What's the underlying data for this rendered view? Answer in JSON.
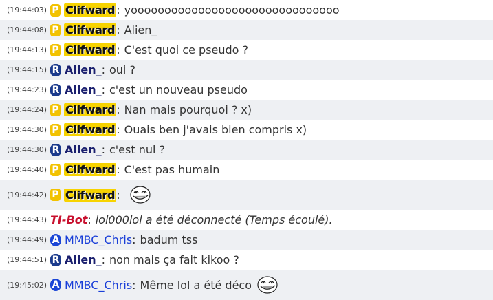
{
  "messages": [
    {
      "time": "(19:44:03)",
      "badge": "P",
      "user": "Clifward",
      "text": "yooooooooooooooooooooooooooooooo"
    },
    {
      "time": "(19:44:08)",
      "badge": "P",
      "user": "Clifward",
      "text": "Alien_"
    },
    {
      "time": "(19:44:13)",
      "badge": "P",
      "user": "Clifward",
      "text": "C'est quoi ce pseudo ?"
    },
    {
      "time": "(19:44:15)",
      "badge": "R",
      "user": "Alien_",
      "text": "oui ?"
    },
    {
      "time": "(19:44:23)",
      "badge": "R",
      "user": "Alien_",
      "text": "c'est un nouveau pseudo"
    },
    {
      "time": "(19:44:24)",
      "badge": "P",
      "user": "Clifward",
      "text": "Nan mais pourquoi ? x)"
    },
    {
      "time": "(19:44:30)",
      "badge": "P",
      "user": "Clifward",
      "text": "Ouais ben j'avais bien compris x)"
    },
    {
      "time": "(19:44:30)",
      "badge": "R",
      "user": "Alien_",
      "text": "c'est nul ?"
    },
    {
      "time": "(19:44:40)",
      "badge": "P",
      "user": "Clifward",
      "text": "C'est pas humain"
    },
    {
      "time": "(19:44:42)",
      "badge": "P",
      "user": "Clifward",
      "text": "",
      "icon": "trollface-icon"
    },
    {
      "time": "(19:44:43)",
      "badge": "",
      "user": "TI-Bot",
      "text": "lol000lol a été déconnecté (Temps écoulé)."
    },
    {
      "time": "(19:44:49)",
      "badge": "A",
      "user": "MMBC_Chris",
      "text": "badum tss"
    },
    {
      "time": "(19:44:51)",
      "badge": "R",
      "user": "Alien_",
      "text": "non mais ça fait kikoo ?"
    },
    {
      "time": "(19:45:02)",
      "badge": "A",
      "user": "MMBC_Chris",
      "text": "Même lol a été déco",
      "icon": "trollface-icon"
    }
  ],
  "separator": ":",
  "colors": {
    "clifward_bg": "#f7d300",
    "alien": "#1a1f6e",
    "mmbc": "#1a3fd8",
    "bot": "#c8102e"
  }
}
